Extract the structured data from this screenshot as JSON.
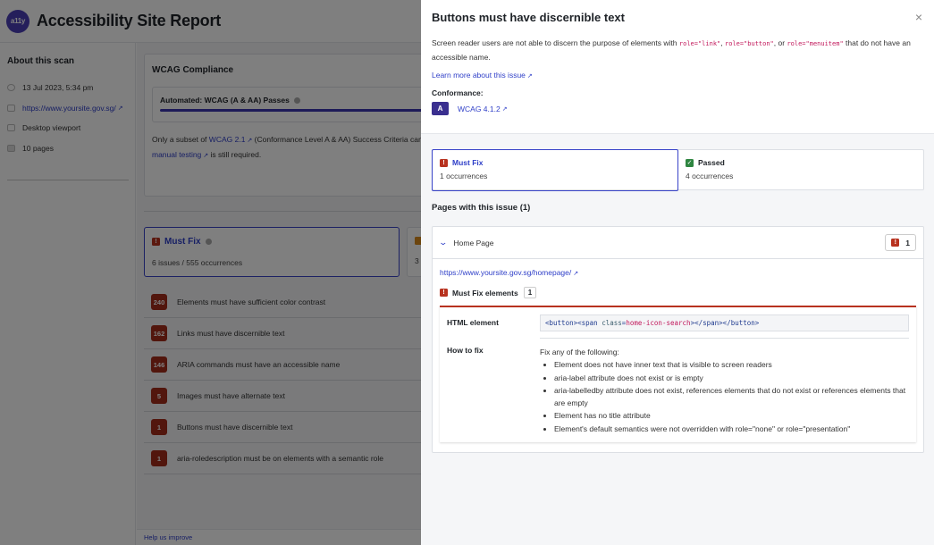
{
  "app": {
    "logo_text": "a11y",
    "title": "Accessibility Site Report"
  },
  "sidebar": {
    "heading": "About this scan",
    "items": [
      {
        "icon": "clock-icon",
        "text": "13 Jul 2023, 5:34 pm",
        "link": false
      },
      {
        "icon": "browser-icon",
        "text": "https://www.yoursite.gov.sg/",
        "link": true
      },
      {
        "icon": "monitor-icon",
        "text": "Desktop viewport",
        "link": false
      },
      {
        "icon": "pages-icon",
        "text": "10 pages",
        "link": false
      }
    ]
  },
  "compliance": {
    "heading": "WCAG Compliance",
    "passes_label": "Automated: WCAG (A & AA) Passes",
    "passes_progress_percent": 100,
    "note_prefix": "Only a subset of ",
    "note_link1": "WCAG 2.1",
    "note_middle": " (Conformance Level A & AA) Success Criteria can b",
    "note_link2": "manual testing",
    "note_suffix": " is still required."
  },
  "summary_cards": {
    "must_fix": {
      "title": "Must Fix",
      "sub": "6 issues / 555 occurrences"
    },
    "other": {
      "sub": "3"
    }
  },
  "issues": [
    {
      "count": "240",
      "label": "Elements must have sufficient color contrast"
    },
    {
      "count": "162",
      "label": "Links must have discernible text"
    },
    {
      "count": "146",
      "label": "ARIA commands must have an accessible name"
    },
    {
      "count": "5",
      "label": "Images must have alternate text"
    },
    {
      "count": "1",
      "label": "Buttons must have discernible text"
    },
    {
      "count": "1",
      "label": "aria-roledescription must be on elements with a semantic role"
    }
  ],
  "footer": {
    "help_link": "Help us improve"
  },
  "drawer": {
    "title": "Buttons must have discernible text",
    "close_icon": "×",
    "desc_prefix": "Screen reader users are not able to discern the purpose of elements with ",
    "role1": "role=\"link\"",
    "sep1": ", ",
    "role2": "role=\"button\"",
    "sep2": ", or ",
    "role3": "role=\"menuitem\"",
    "desc_suffix": " that do not have an accessible name.",
    "learn_more": "Learn more about this issue",
    "conformance_label": "Conformance:",
    "level": "A",
    "wcag_ref": "WCAG 4.1.2",
    "tabs": [
      {
        "title": "Must Fix",
        "sub": "1 occurrences",
        "icon": "!"
      },
      {
        "title": "Passed",
        "sub": "4 occurrences",
        "icon": "✓"
      }
    ],
    "pages_heading": "Pages with this issue (1)",
    "page": {
      "name": "Home Page",
      "count": "1",
      "url": "https://www.yoursite.gov.sg/homepage/",
      "must_fix_label": "Must Fix elements",
      "must_fix_count": "1",
      "html_element_label": "HTML element",
      "code_open": "<button><span ",
      "code_attr_name": "class",
      "code_eq": "=",
      "code_attr_val": "home-icon-search",
      "code_close": "></span></button>",
      "how_to_fix_label": "How to fix",
      "fix_intro": "Fix any of the following:",
      "fix_items": [
        "Element does not have inner text that is visible to screen readers",
        "aria-label attribute does not exist or is empty",
        "aria-labelledby attribute does not exist, references elements that do not exist or references elements that are empty",
        "Element has no title attribute",
        "Element's default semantics were not overridden with role=\"none\" or role=\"presentation\""
      ]
    }
  },
  "colors": {
    "brand": "#4b3fb6",
    "must_fix_red": "#b8321f",
    "passed_green": "#2e8540",
    "link_blue": "#2f3fc8",
    "active_border": "#3843c8"
  }
}
